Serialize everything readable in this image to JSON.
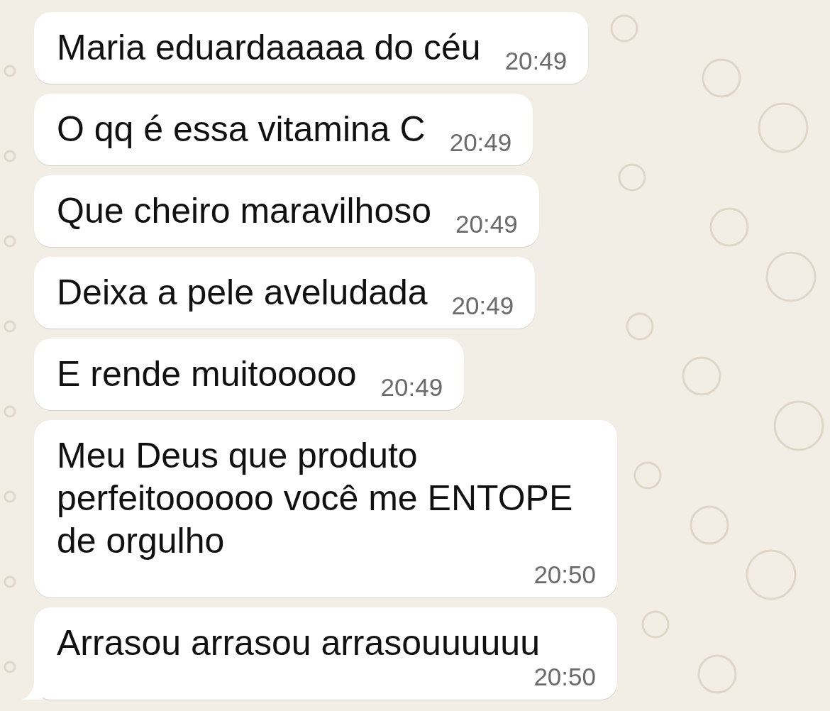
{
  "messages": [
    {
      "text": "Maria eduardaaaaa do céu",
      "time": "20:49"
    },
    {
      "text": "O qq é essa vitamina C",
      "time": "20:49"
    },
    {
      "text": "Que cheiro maravilhoso",
      "time": "20:49"
    },
    {
      "text": "Deixa a pele aveludada",
      "time": "20:49"
    },
    {
      "text": "E rende muitooooo",
      "time": "20:49"
    },
    {
      "text": "Meu Deus que produto perfeitoooooo você me ENTOPE de orgulho",
      "time": "20:50"
    },
    {
      "text": "Arrasou arrasou arrasouuuuuu",
      "time": "20:50"
    }
  ]
}
